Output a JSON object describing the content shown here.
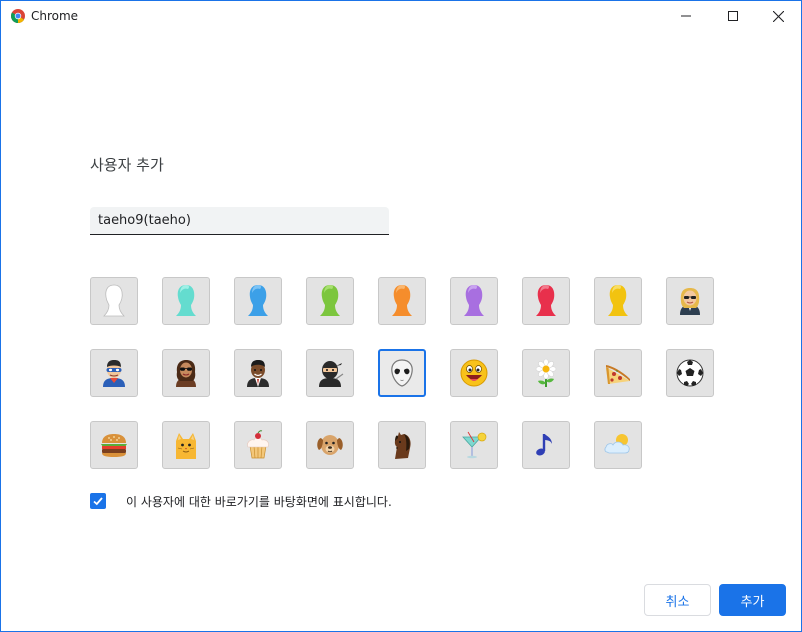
{
  "window": {
    "title": "Chrome",
    "logo_icon": "chrome-logo-icon"
  },
  "dialog": {
    "title": "사용자 추가",
    "name_value": "taeho9(taeho)",
    "shortcut_label": "이 사용자에 대한 바로가기를 바탕화면에 표시합니다.",
    "shortcut_checked": true,
    "cancel_label": "취소",
    "add_label": "추가"
  },
  "avatars": [
    {
      "name": "generic-white",
      "color": "#ffffff"
    },
    {
      "name": "generic-cyan",
      "color": "#64dccf"
    },
    {
      "name": "generic-blue",
      "color": "#3ca0e8"
    },
    {
      "name": "generic-green",
      "color": "#7cc63e"
    },
    {
      "name": "generic-orange",
      "color": "#f58d2c"
    },
    {
      "name": "generic-purple",
      "color": "#a86fe0"
    },
    {
      "name": "generic-red",
      "color": "#e8304c"
    },
    {
      "name": "generic-yellow",
      "color": "#f2c310"
    },
    {
      "name": "businesswoman"
    },
    {
      "name": "superhero"
    },
    {
      "name": "woman-sunglasses"
    },
    {
      "name": "businessman"
    },
    {
      "name": "ninja"
    },
    {
      "name": "alien",
      "selected": true
    },
    {
      "name": "smiley"
    },
    {
      "name": "flower"
    },
    {
      "name": "pizza"
    },
    {
      "name": "soccer-ball"
    },
    {
      "name": "burger"
    },
    {
      "name": "cat"
    },
    {
      "name": "cupcake"
    },
    {
      "name": "dog"
    },
    {
      "name": "horse"
    },
    {
      "name": "cocktail"
    },
    {
      "name": "music-note"
    },
    {
      "name": "sun-cloud"
    }
  ],
  "colors": {
    "accent": "#1a73e8"
  }
}
